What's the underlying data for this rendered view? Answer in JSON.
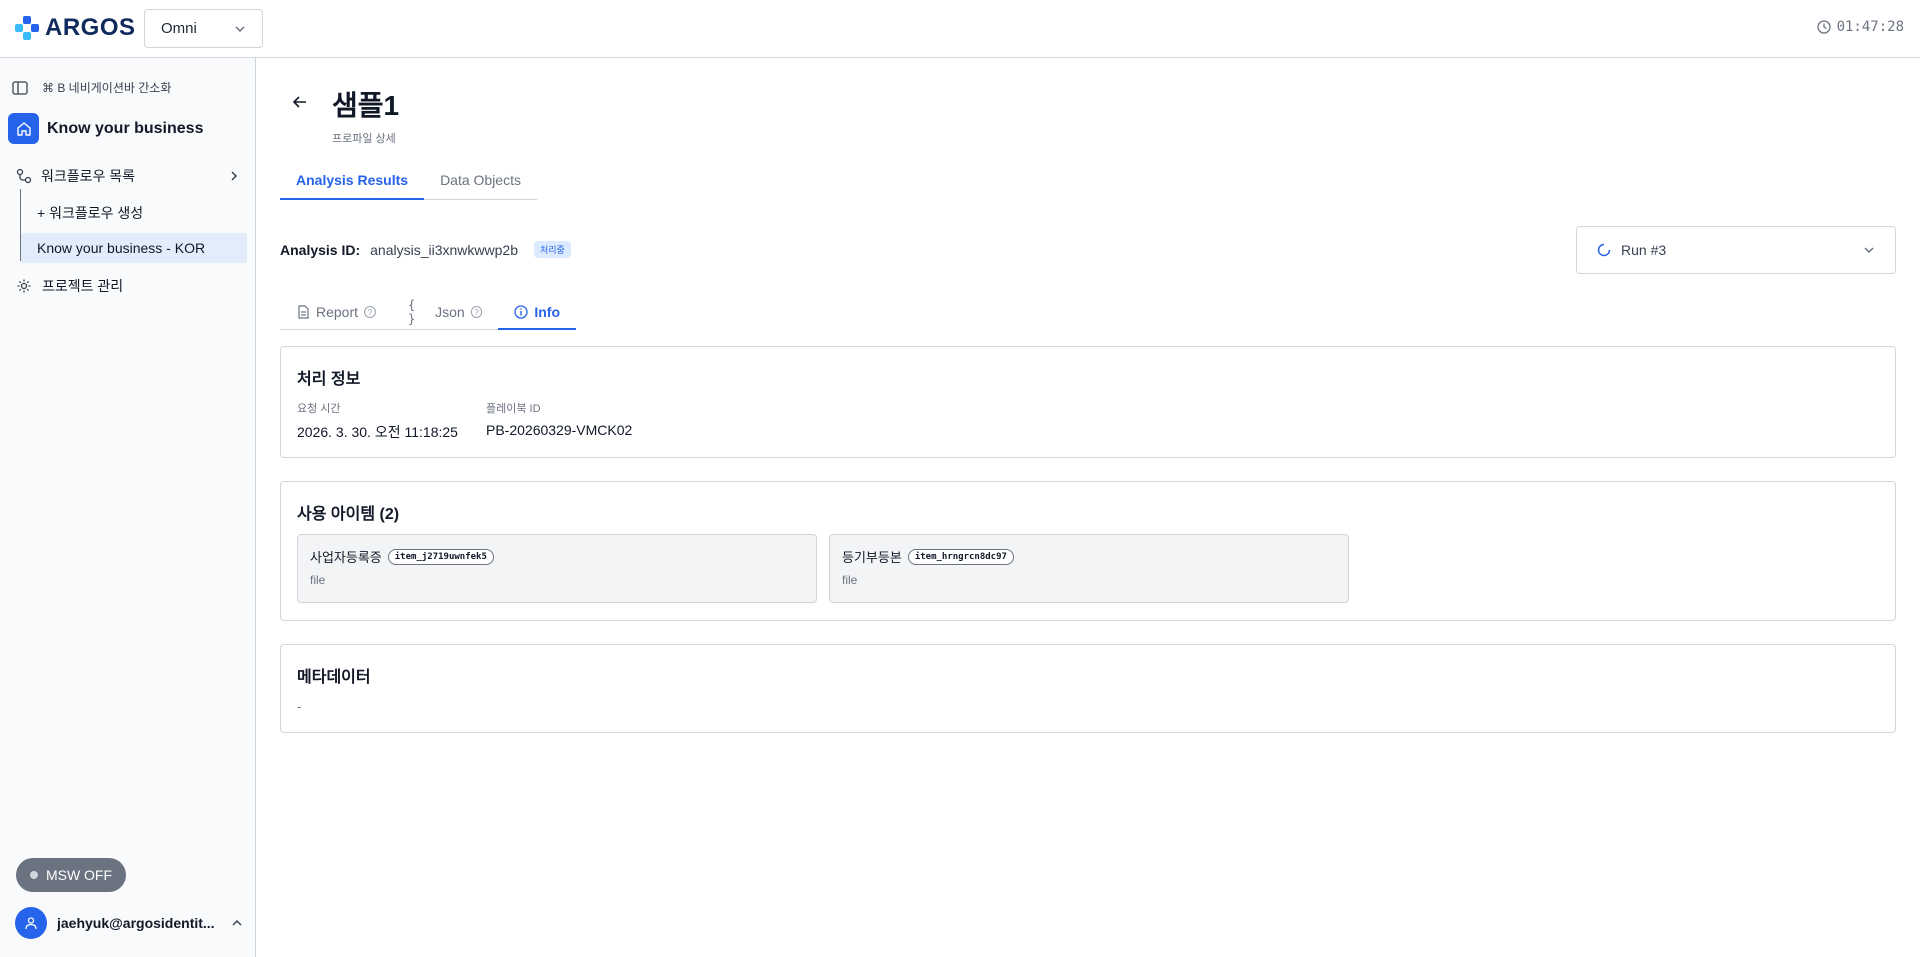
{
  "app": {
    "brand": "ARGOS",
    "workspace": "Omni",
    "clock": "01:47:28"
  },
  "sidebar": {
    "toggle_label": "⌘ B 네비게이션바 간소화",
    "project_name": "Know your business",
    "workflows_label": "워크플로우 목록",
    "create_label": "+ 워크플로우 생성",
    "active_workflow": "Know your business - KOR",
    "manage_label": "프로젝트 관리",
    "msw_label": "MSW OFF",
    "user_email": "jaehyuk@argosidentit..."
  },
  "page": {
    "title": "샘플1",
    "subtitle": "프로파일 상세",
    "tabs": [
      "Analysis Results",
      "Data Objects"
    ]
  },
  "analysis": {
    "label": "Analysis ID:",
    "id": "analysis_ii3xnwkwwp2b",
    "status": "처리중",
    "run": "Run #3"
  },
  "sub_tabs": {
    "report": "Report",
    "json": "Json",
    "info": "Info"
  },
  "processing": {
    "title": "처리 정보",
    "request_time_label": "요청 시간",
    "request_time": "2026. 3. 30. 오전 11:18:25",
    "playbook_label": "플레이북 ID",
    "playbook_id": "PB-20260329-VMCK02"
  },
  "items": {
    "title": "사용 아이템 (2)",
    "list": [
      {
        "name": "사업자등록증",
        "code": "item_j2719uwnfek5",
        "type": "file"
      },
      {
        "name": "등기부등본",
        "code": "item_hrngrcn8dc97",
        "type": "file"
      }
    ]
  },
  "metadata": {
    "title": "메타데이터",
    "value": "-"
  },
  "colors": {
    "accent": "#2563eb",
    "active_nav_bg": "#e3ecfb",
    "brand_dark": "#0f2a5c"
  }
}
